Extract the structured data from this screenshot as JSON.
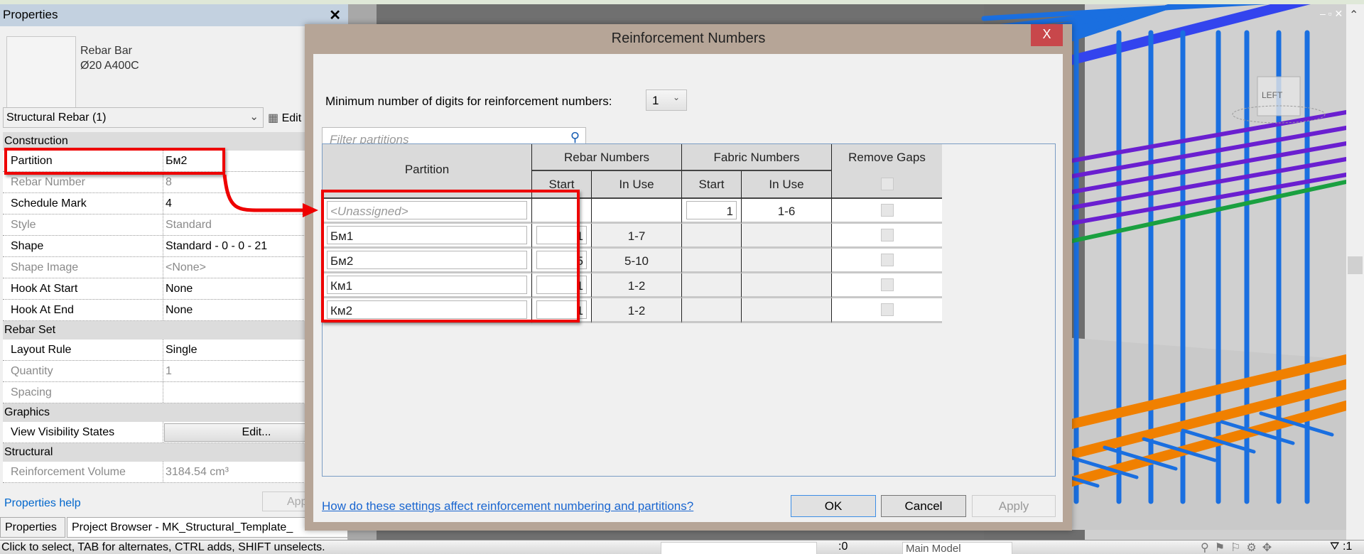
{
  "properties": {
    "title": "Properties",
    "close_icon": "close-icon",
    "type_name_line1": "Rebar Bar",
    "type_name_line2": "Ø20 A400C",
    "type_selector": "Structural Rebar (1)",
    "edit_type_label": "Edit",
    "groups": [
      {
        "label": "Construction",
        "rows": [
          {
            "key": "Partition",
            "value": "Бм2",
            "readonly": false
          },
          {
            "key": "Rebar Number",
            "value": "8",
            "readonly": true
          },
          {
            "key": "Schedule Mark",
            "value": "4",
            "readonly": false
          },
          {
            "key": "Style",
            "value": "Standard",
            "readonly": true
          },
          {
            "key": "Shape",
            "value": "Standard - 0 - 0 - 21",
            "readonly": false
          },
          {
            "key": "Shape Image",
            "value": "<None>",
            "readonly": true
          },
          {
            "key": "Hook At Start",
            "value": "None",
            "readonly": false
          },
          {
            "key": "Hook At End",
            "value": "None",
            "readonly": false
          }
        ]
      },
      {
        "label": "Rebar Set",
        "rows": [
          {
            "key": "Layout Rule",
            "value": "Single",
            "readonly": false
          },
          {
            "key": "Quantity",
            "value": "1",
            "readonly": true
          },
          {
            "key": "Spacing",
            "value": "",
            "readonly": true
          }
        ]
      },
      {
        "label": "Graphics",
        "rows": [
          {
            "key": "View Visibility States",
            "value": "Edit...",
            "button": true
          }
        ]
      },
      {
        "label": "Structural",
        "rows": [
          {
            "key": "Reinforcement Volume",
            "value": "3184.54 cm³",
            "readonly": true
          }
        ]
      }
    ],
    "help_link": "Properties help",
    "apply_label": "Apply",
    "tabs": [
      "Properties",
      "Project Browser - MK_Structural_Template_"
    ]
  },
  "dialog": {
    "title": "Reinforcement Numbers",
    "close_label": "X",
    "min_digits_label": "Minimum number of digits for reinforcement numbers:",
    "min_digits_value": "1",
    "filter_placeholder": "Filter partitions",
    "table": {
      "headers": {
        "partition": "Partition",
        "rebar_numbers": "Rebar Numbers",
        "fabric_numbers": "Fabric Numbers",
        "remove_gaps": "Remove Gaps",
        "start": "Start",
        "in_use": "In Use"
      },
      "rows": [
        {
          "partition": "<Unassigned>",
          "rebar_start": "",
          "rebar_in_use": "",
          "fabric_start": "1",
          "fabric_in_use": "1-6",
          "remove_gaps": false
        },
        {
          "partition": "Бм1",
          "rebar_start": "1",
          "rebar_in_use": "1-7",
          "fabric_start": "",
          "fabric_in_use": "",
          "remove_gaps": false
        },
        {
          "partition": "Бм2",
          "rebar_start": "5",
          "rebar_in_use": "5-10",
          "fabric_start": "",
          "fabric_in_use": "",
          "remove_gaps": false
        },
        {
          "partition": "Км1",
          "rebar_start": "1",
          "rebar_in_use": "1-2",
          "fabric_start": "",
          "fabric_in_use": "",
          "remove_gaps": false
        },
        {
          "partition": "Км2",
          "rebar_start": "1",
          "rebar_in_use": "1-2",
          "fabric_start": "",
          "fabric_in_use": "",
          "remove_gaps": false
        }
      ]
    },
    "help_link": "How do these settings affect reinforcement numbering and partitions?",
    "buttons": {
      "ok": "OK",
      "cancel": "Cancel",
      "apply": "Apply"
    }
  },
  "viewcube_label": "LEFT",
  "status_bar": {
    "message": "Click to select, TAB for alternates, CTRL adds, SHIFT unselects.",
    "selection_count": ":0",
    "model": "Main Model",
    "filter_count": ":1"
  },
  "colors": {
    "highlight": "#ee0000",
    "dialog_frame": "#b6a597",
    "close_button": "#c8474b",
    "rebar_blue": "#1a6fe0",
    "rebar_purple": "#6a1fd0",
    "rebar_green": "#1aa040",
    "rebar_orange": "#f08000"
  }
}
